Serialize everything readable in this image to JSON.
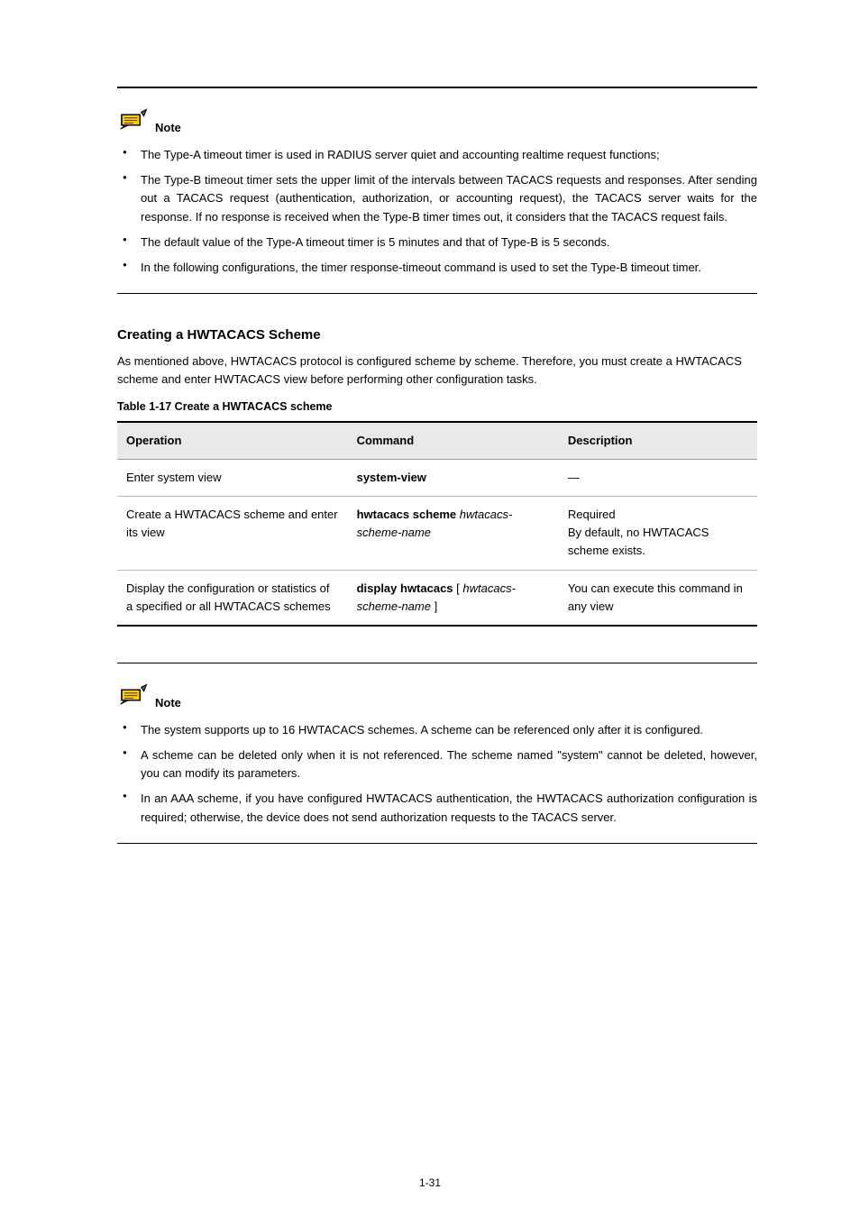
{
  "notes": {
    "label": "Note",
    "top": [
      "The Type-A timeout timer is used in RADIUS server quiet and accounting realtime request functions;",
      "The Type-B timeout timer sets the upper limit of the intervals between TACACS requests and responses. After sending out a TACACS request (authentication, authorization, or accounting request), the TACACS server waits for the response. If no response is received when the Type-B timer times out, it considers that the TACACS request fails.",
      "The default value of the Type-A timeout timer is 5 minutes and that of Type-B is 5 seconds.",
      "In the following configurations, the timer response-timeout command is used to set the Type-B timeout timer."
    ],
    "bottom": [
      "The system supports up to 16 HWTACACS schemes. A scheme can be referenced only after it is configured.",
      "A scheme can be deleted only when it is not referenced. The scheme named \"system\" cannot be deleted, however, you can modify its parameters.",
      "In an AAA scheme, if you have configured HWTACACS authentication, the HWTACACS authorization configuration is required; otherwise, the device does not send authorization requests to the TACACS server."
    ]
  },
  "section": {
    "title": "Creating a HWTACACS Scheme",
    "intro": "As mentioned above, HWTACACS protocol is configured scheme by scheme. Therefore, you must create a HWTACACS scheme and enter HWTACACS view before performing other configuration tasks."
  },
  "table": {
    "caption": "Table 1-17 Create a HWTACACS scheme",
    "headers": [
      "Operation",
      "Command",
      "Description"
    ],
    "rows": [
      {
        "op": "Enter system view",
        "cmd_bold": "system-view",
        "cmd_ital": "",
        "desc": "—"
      },
      {
        "op": "Create a HWTACACS scheme and enter its view",
        "cmd_bold": "hwtacacs scheme",
        "cmd_ital": " hwtacacs-scheme-name",
        "desc": "Required\nBy default, no HWTACACS scheme exists."
      },
      {
        "op": "Display the configuration or statistics of a specified or all HWTACACS schemes",
        "cmd_bold": "display hwtacacs",
        "cmd_ital": "",
        "cmd_tail_plain": " [ ",
        "cmd_tail_ital": "hwtacacs-scheme-name",
        "cmd_tail_plain2": " ]",
        "desc": "You can execute this command in any view"
      }
    ]
  },
  "footer": "1-31"
}
